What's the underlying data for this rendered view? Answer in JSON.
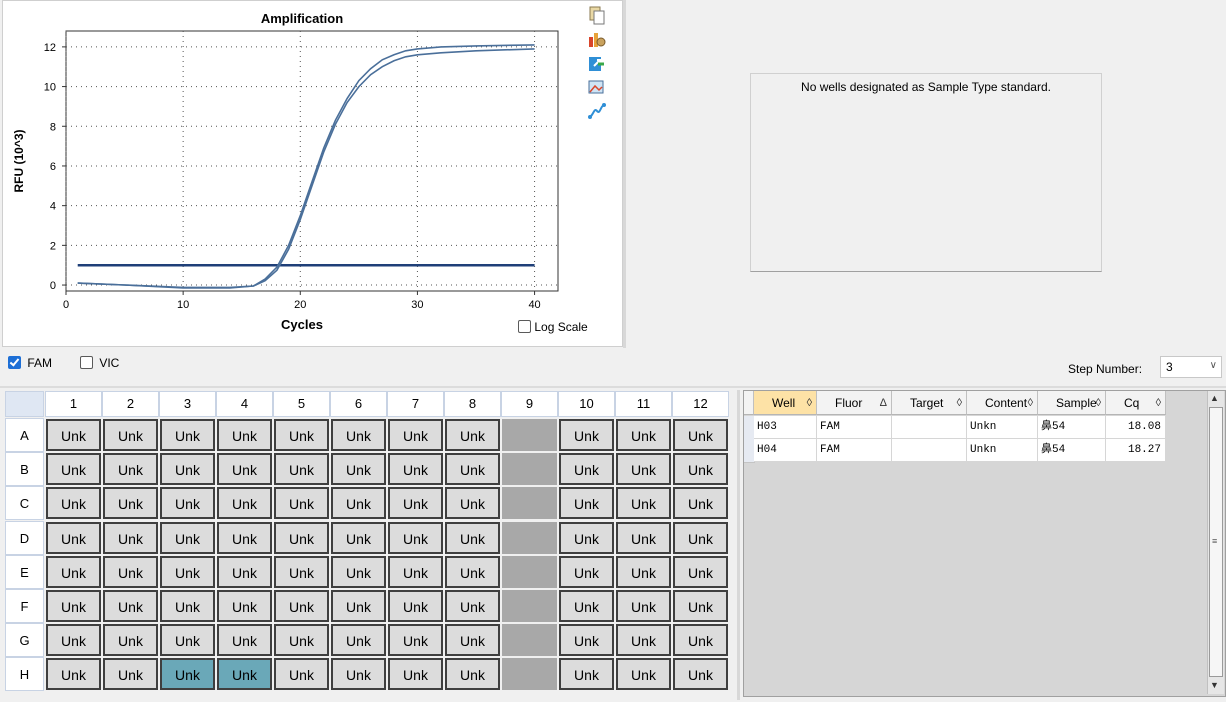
{
  "chart_panel": {
    "toolbar_icons": [
      "copy-icon",
      "chart-settings-icon",
      "export-icon",
      "image-icon",
      "trace-style-icon"
    ],
    "log_scale_label": "Log Scale",
    "log_scale_checked": false
  },
  "chart_data": {
    "type": "line",
    "title": "Amplification",
    "xlabel": "Cycles",
    "ylabel": "RFU (10^3)",
    "xlim": [
      0,
      42
    ],
    "ylim": [
      -0.3,
      12.8
    ],
    "xticks": [
      0,
      10,
      20,
      30,
      40
    ],
    "yticks": [
      0,
      2,
      4,
      6,
      8,
      10,
      12
    ],
    "grid": true,
    "threshold": 1.0,
    "series": [
      {
        "cq": 18.08,
        "x": [
          1,
          5,
          10,
          14,
          16,
          17,
          18,
          19,
          20,
          21,
          22,
          23,
          24,
          25,
          26,
          27,
          28,
          29,
          30,
          32,
          35,
          40
        ],
        "y": [
          0.1,
          0.0,
          -0.15,
          -0.15,
          -0.05,
          0.3,
          0.9,
          2.0,
          3.5,
          5.2,
          6.9,
          8.3,
          9.4,
          10.3,
          10.9,
          11.35,
          11.6,
          11.8,
          11.9,
          12.0,
          12.05,
          12.1
        ],
        "color": "#4a6f9a"
      },
      {
        "cq": 18.27,
        "x": [
          1,
          5,
          10,
          14,
          16,
          17,
          18,
          19,
          20,
          21,
          22,
          23,
          24,
          25,
          26,
          27,
          28,
          29,
          30,
          32,
          35,
          40
        ],
        "y": [
          0.1,
          0.0,
          -0.12,
          -0.12,
          -0.05,
          0.22,
          0.75,
          1.8,
          3.3,
          5.0,
          6.7,
          8.1,
          9.2,
          10.0,
          10.6,
          11.0,
          11.3,
          11.5,
          11.6,
          11.7,
          11.8,
          11.9
        ],
        "color": "#4a6f9a"
      }
    ],
    "threshold_color": "#1f3f78"
  },
  "std_curve": {
    "message": "No wells designated as Sample Type standard."
  },
  "fluors": [
    {
      "label": "FAM",
      "checked": true
    },
    {
      "label": "VIC",
      "checked": false
    }
  ],
  "step": {
    "label": "Step Number:",
    "value": "3"
  },
  "plate": {
    "columns": [
      "1",
      "2",
      "3",
      "4",
      "5",
      "6",
      "7",
      "8",
      "9",
      "10",
      "11",
      "12"
    ],
    "rows": [
      "A",
      "B",
      "C",
      "D",
      "E",
      "F",
      "G",
      "H"
    ],
    "well_label": "Unk",
    "empty_column": "9",
    "selected": [
      "H3",
      "H4"
    ]
  },
  "grid": {
    "columns": [
      {
        "label": "Well",
        "sort": "◊",
        "sorted": true
      },
      {
        "label": "Fluor",
        "sort": "Δ",
        "sorted": false
      },
      {
        "label": "Target",
        "sort": "◊",
        "sorted": false
      },
      {
        "label": "Content",
        "sort": "◊",
        "sorted": false
      },
      {
        "label": "Sample",
        "sort": "◊",
        "sorted": false
      },
      {
        "label": "Cq",
        "sort": "◊",
        "sorted": false
      }
    ],
    "rows": [
      {
        "well": "H03",
        "fluor": "FAM",
        "target": "",
        "content": "Unkn",
        "sample": "鼻54",
        "cq": "18.08"
      },
      {
        "well": "H04",
        "fluor": "FAM",
        "target": "",
        "content": "Unkn",
        "sample": "鼻54",
        "cq": "18.27"
      }
    ]
  },
  "colors": {
    "selected_well": "#6aa8b8",
    "sorted_header": "#fde2a6",
    "checkbox_accent": "#1d6fd6"
  }
}
